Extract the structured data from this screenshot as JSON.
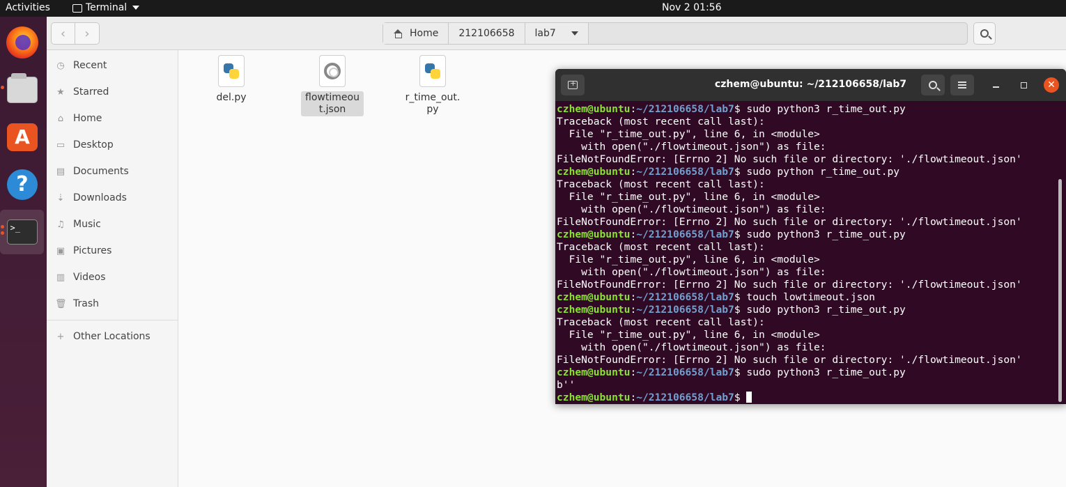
{
  "topbar": {
    "activities": "Activities",
    "app_name": "Terminal",
    "clock": "Nov 2  01:56"
  },
  "dock": {
    "items": [
      {
        "name": "firefox-icon"
      },
      {
        "name": "files-icon"
      },
      {
        "name": "software-store-icon"
      },
      {
        "name": "help-icon"
      },
      {
        "name": "terminal-icon"
      }
    ]
  },
  "files": {
    "path": [
      "Home",
      "212106658",
      "lab7"
    ],
    "sidebar": [
      {
        "label": "Recent",
        "icon": "clock-icon"
      },
      {
        "label": "Starred",
        "icon": "star-icon"
      },
      {
        "label": "Home",
        "icon": "home-icon"
      },
      {
        "label": "Desktop",
        "icon": "desktop-icon"
      },
      {
        "label": "Documents",
        "icon": "documents-icon"
      },
      {
        "label": "Downloads",
        "icon": "downloads-icon"
      },
      {
        "label": "Music",
        "icon": "music-icon"
      },
      {
        "label": "Pictures",
        "icon": "pictures-icon"
      },
      {
        "label": "Videos",
        "icon": "videos-icon"
      },
      {
        "label": "Trash",
        "icon": "trash-icon"
      }
    ],
    "other_locations": "Other Locations",
    "items": [
      {
        "name": "del.py",
        "type": "python"
      },
      {
        "name": "flowtimeout.json",
        "type": "json",
        "selected": true
      },
      {
        "name": "r_time_out.py",
        "type": "python"
      }
    ]
  },
  "terminal": {
    "title": "czhem@ubuntu: ~/212106658/lab7",
    "prompt_user": "czhem@ubuntu",
    "prompt_path": "~/212106658/lab7",
    "lines": [
      {
        "kind": "cmd",
        "text": "sudo python3 r_time_out.py"
      },
      {
        "kind": "out",
        "text": "Traceback (most recent call last):"
      },
      {
        "kind": "out",
        "text": "  File \"r_time_out.py\", line 6, in <module>"
      },
      {
        "kind": "out",
        "text": "    with open(\"./flowtimeout.json\") as file:"
      },
      {
        "kind": "out",
        "text": "FileNotFoundError: [Errno 2] No such file or directory: './flowtimeout.json'"
      },
      {
        "kind": "cmd",
        "text": "sudo python r_time_out.py"
      },
      {
        "kind": "out",
        "text": "Traceback (most recent call last):"
      },
      {
        "kind": "out",
        "text": "  File \"r_time_out.py\", line 6, in <module>"
      },
      {
        "kind": "out",
        "text": "    with open(\"./flowtimeout.json\") as file:"
      },
      {
        "kind": "out",
        "text": "FileNotFoundError: [Errno 2] No such file or directory: './flowtimeout.json'"
      },
      {
        "kind": "cmd",
        "text": "sudo python3 r_time_out.py"
      },
      {
        "kind": "out",
        "text": "Traceback (most recent call last):"
      },
      {
        "kind": "out",
        "text": "  File \"r_time_out.py\", line 6, in <module>"
      },
      {
        "kind": "out",
        "text": "    with open(\"./flowtimeout.json\") as file:"
      },
      {
        "kind": "out",
        "text": "FileNotFoundError: [Errno 2] No such file or directory: './flowtimeout.json'"
      },
      {
        "kind": "cmd",
        "text": "touch lowtimeout.json"
      },
      {
        "kind": "cmd",
        "text": "sudo python3 r_time_out.py"
      },
      {
        "kind": "out",
        "text": "Traceback (most recent call last):"
      },
      {
        "kind": "out",
        "text": "  File \"r_time_out.py\", line 6, in <module>"
      },
      {
        "kind": "out",
        "text": "    with open(\"./flowtimeout.json\") as file:"
      },
      {
        "kind": "out",
        "text": "FileNotFoundError: [Errno 2] No such file or directory: './flowtimeout.json'"
      },
      {
        "kind": "cmd",
        "text": "sudo python3 r_time_out.py"
      },
      {
        "kind": "out",
        "text": "b''"
      },
      {
        "kind": "cmd",
        "text": ""
      }
    ]
  },
  "colors": {
    "terminal_bg": "#300a24",
    "prompt_user": "#8ae234",
    "prompt_path": "#729fcf",
    "accent": "#e95420"
  }
}
